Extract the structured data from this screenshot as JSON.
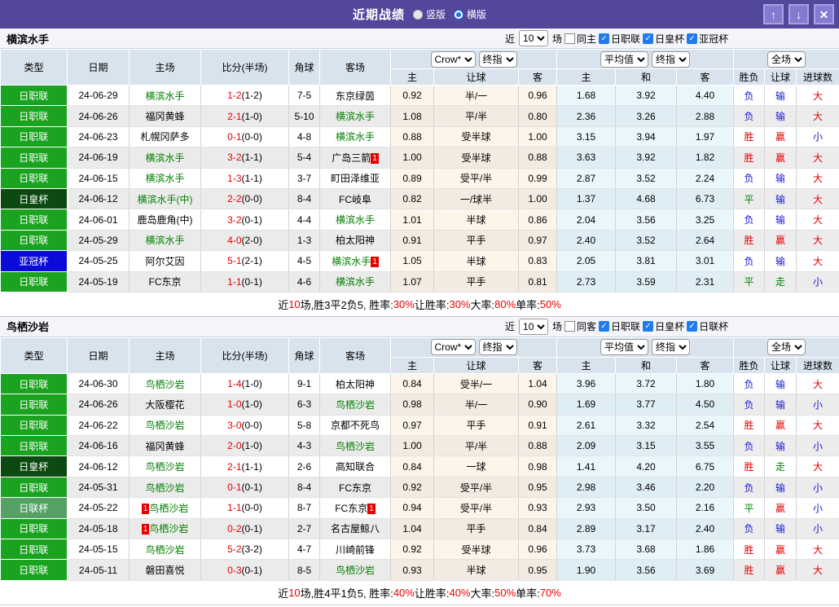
{
  "titlebar": {
    "title": "近期战绩",
    "layout_vertical": "竖版",
    "layout_horizontal": "横版",
    "selected_layout": "横版",
    "buttons": {
      "up": "↑",
      "down": "↓",
      "close": "✕"
    }
  },
  "filter_labels": {
    "near": "近",
    "games_unit": "场"
  },
  "table_header": {
    "main": [
      "类型",
      "日期",
      "主场",
      "比分(半场)",
      "角球",
      "客场"
    ],
    "sub": [
      "主",
      "让球",
      "客",
      "主",
      "和",
      "客",
      "胜负",
      "让球",
      "进球数"
    ],
    "odds_selects": {
      "bookmaker": "Crow*",
      "bookmaker_stage": "终指",
      "average": "平均值",
      "average_stage": "终指",
      "scope": "全场"
    }
  },
  "colors": {
    "titlebar_bg": "#53479c",
    "button_bg": "#837bd0",
    "header_bg": "#d9e3ee",
    "checkbox_blue": "#1f7bf0",
    "score_red": "#e60000",
    "focus_team": "#008000",
    "types": {
      "日职联": "#1aa31e",
      "日皇杯": "#0d4a12",
      "亚冠杯": "#0a0ad9",
      "日联杯": "#55a065"
    },
    "verdict": {
      "r": "#e60000",
      "b": "#1616d1",
      "g": "#008a00"
    }
  },
  "sections": [
    {
      "team": "横滨水手",
      "filter": {
        "games": "10",
        "same_label": "同主",
        "same_checked": false,
        "leagues": [
          {
            "label": "日职联",
            "checked": true
          },
          {
            "label": "日皇杯",
            "checked": true
          },
          {
            "label": "亚冠杯",
            "checked": true
          }
        ]
      },
      "rows": [
        {
          "type": "日职联",
          "date": "24-06-29",
          "home": {
            "name": "横滨水手",
            "focus": true
          },
          "score": "1-2",
          "half": "(1-2)",
          "corner": "7-5",
          "away": {
            "name": "东京绿茵"
          },
          "crow": [
            "0.92",
            "半/一",
            "0.96"
          ],
          "avg": [
            "1.68",
            "3.92",
            "4.40"
          ],
          "verdicts": [
            [
              "负",
              "b"
            ],
            [
              "输",
              "b"
            ],
            [
              "大",
              "r"
            ]
          ]
        },
        {
          "type": "日职联",
          "date": "24-06-26",
          "home": {
            "name": "福冈黄蜂"
          },
          "score": "2-1",
          "half": "(1-0)",
          "corner": "5-10",
          "away": {
            "name": "横滨水手",
            "focus": true
          },
          "crow": [
            "1.08",
            "平/半",
            "0.80"
          ],
          "avg": [
            "2.36",
            "3.26",
            "2.88"
          ],
          "verdicts": [
            [
              "负",
              "b"
            ],
            [
              "输",
              "b"
            ],
            [
              "大",
              "r"
            ]
          ]
        },
        {
          "type": "日职联",
          "date": "24-06-23",
          "home": {
            "name": "札幌冈萨多"
          },
          "score": "0-1",
          "half": "(0-0)",
          "corner": "4-8",
          "away": {
            "name": "横滨水手",
            "focus": true
          },
          "crow": [
            "0.88",
            "受半球",
            "1.00"
          ],
          "avg": [
            "3.15",
            "3.94",
            "1.97"
          ],
          "verdicts": [
            [
              "胜",
              "r"
            ],
            [
              "赢",
              "r"
            ],
            [
              "小",
              "b"
            ]
          ]
        },
        {
          "type": "日职联",
          "date": "24-06-19",
          "home": {
            "name": "横滨水手",
            "focus": true
          },
          "score": "3-2",
          "half": "(1-1)",
          "corner": "5-4",
          "away": {
            "name": "广岛三箭",
            "badge": "1"
          },
          "crow": [
            "1.00",
            "受半球",
            "0.88"
          ],
          "avg": [
            "3.63",
            "3.92",
            "1.82"
          ],
          "verdicts": [
            [
              "胜",
              "r"
            ],
            [
              "赢",
              "r"
            ],
            [
              "大",
              "r"
            ]
          ]
        },
        {
          "type": "日职联",
          "date": "24-06-15",
          "home": {
            "name": "横滨水手",
            "focus": true
          },
          "score": "1-3",
          "half": "(1-1)",
          "corner": "3-7",
          "away": {
            "name": "町田泽维亚"
          },
          "crow": [
            "0.89",
            "受平/半",
            "0.99"
          ],
          "avg": [
            "2.87",
            "3.52",
            "2.24"
          ],
          "verdicts": [
            [
              "负",
              "b"
            ],
            [
              "输",
              "b"
            ],
            [
              "大",
              "r"
            ]
          ]
        },
        {
          "type": "日皇杯",
          "date": "24-06-12",
          "home": {
            "name": "横滨水手(中)",
            "focus": true
          },
          "score": "2-2",
          "half": "(0-0)",
          "corner": "8-4",
          "away": {
            "name": "FC岐阜"
          },
          "crow": [
            "0.82",
            "一/球半",
            "1.00"
          ],
          "avg": [
            "1.37",
            "4.68",
            "6.73"
          ],
          "verdicts": [
            [
              "平",
              "g"
            ],
            [
              "输",
              "b"
            ],
            [
              "大",
              "r"
            ]
          ]
        },
        {
          "type": "日职联",
          "date": "24-06-01",
          "home": {
            "name": "鹿岛鹿角(中)"
          },
          "score": "3-2",
          "half": "(0-1)",
          "corner": "4-4",
          "away": {
            "name": "横滨水手",
            "focus": true
          },
          "crow": [
            "1.01",
            "半球",
            "0.86"
          ],
          "avg": [
            "2.04",
            "3.56",
            "3.25"
          ],
          "verdicts": [
            [
              "负",
              "b"
            ],
            [
              "输",
              "b"
            ],
            [
              "大",
              "r"
            ]
          ]
        },
        {
          "type": "日职联",
          "date": "24-05-29",
          "home": {
            "name": "横滨水手",
            "focus": true
          },
          "score": "4-0",
          "half": "(2-0)",
          "corner": "1-3",
          "away": {
            "name": "柏太阳神"
          },
          "crow": [
            "0.91",
            "平手",
            "0.97"
          ],
          "avg": [
            "2.40",
            "3.52",
            "2.64"
          ],
          "verdicts": [
            [
              "胜",
              "r"
            ],
            [
              "赢",
              "r"
            ],
            [
              "大",
              "r"
            ]
          ]
        },
        {
          "type": "亚冠杯",
          "date": "24-05-25",
          "home": {
            "name": "阿尔艾因"
          },
          "score": "5-1",
          "half": "(2-1)",
          "corner": "4-5",
          "away": {
            "name": "横滨水手",
            "focus": true,
            "badge": "1"
          },
          "crow": [
            "1.05",
            "半球",
            "0.83"
          ],
          "avg": [
            "2.05",
            "3.81",
            "3.01"
          ],
          "verdicts": [
            [
              "负",
              "b"
            ],
            [
              "输",
              "b"
            ],
            [
              "大",
              "r"
            ]
          ]
        },
        {
          "type": "日职联",
          "date": "24-05-19",
          "home": {
            "name": "FC东京"
          },
          "score": "1-1",
          "half": "(0-1)",
          "corner": "4-6",
          "away": {
            "name": "横滨水手",
            "focus": true
          },
          "crow": [
            "1.07",
            "平手",
            "0.81"
          ],
          "avg": [
            "2.73",
            "3.59",
            "2.31"
          ],
          "verdicts": [
            [
              "平",
              "g"
            ],
            [
              "走",
              "g"
            ],
            [
              "小",
              "b"
            ]
          ]
        }
      ],
      "summary": [
        {
          "t": "近"
        },
        {
          "t": "10",
          "red": true
        },
        {
          "t": "场,胜3平2负5, 胜率:"
        },
        {
          "t": "30%",
          "red": true
        },
        {
          "t": " 让胜率:"
        },
        {
          "t": "30%",
          "red": true
        },
        {
          "t": " 大率:"
        },
        {
          "t": "80%",
          "red": true
        },
        {
          "t": " 单率:"
        },
        {
          "t": "50%",
          "red": true
        }
      ]
    },
    {
      "team": "鸟栖沙岩",
      "filter": {
        "games": "10",
        "same_label": "同客",
        "same_checked": false,
        "leagues": [
          {
            "label": "日职联",
            "checked": true
          },
          {
            "label": "日皇杯",
            "checked": true
          },
          {
            "label": "日联杯",
            "checked": true
          }
        ]
      },
      "rows": [
        {
          "type": "日职联",
          "date": "24-06-30",
          "home": {
            "name": "鸟栖沙岩",
            "focus": true
          },
          "score": "1-4",
          "half": "(1-0)",
          "corner": "9-1",
          "away": {
            "name": "柏太阳神"
          },
          "crow": [
            "0.84",
            "受半/一",
            "1.04"
          ],
          "avg": [
            "3.96",
            "3.72",
            "1.80"
          ],
          "verdicts": [
            [
              "负",
              "b"
            ],
            [
              "输",
              "b"
            ],
            [
              "大",
              "r"
            ]
          ]
        },
        {
          "type": "日职联",
          "date": "24-06-26",
          "home": {
            "name": "大阪樱花"
          },
          "score": "1-0",
          "half": "(1-0)",
          "corner": "6-3",
          "away": {
            "name": "鸟栖沙岩",
            "focus": true
          },
          "crow": [
            "0.98",
            "半/一",
            "0.90"
          ],
          "avg": [
            "1.69",
            "3.77",
            "4.50"
          ],
          "verdicts": [
            [
              "负",
              "b"
            ],
            [
              "输",
              "b"
            ],
            [
              "小",
              "b"
            ]
          ]
        },
        {
          "type": "日职联",
          "date": "24-06-22",
          "home": {
            "name": "鸟栖沙岩",
            "focus": true
          },
          "score": "3-0",
          "half": "(0-0)",
          "corner": "5-8",
          "away": {
            "name": "京都不死鸟"
          },
          "crow": [
            "0.97",
            "平手",
            "0.91"
          ],
          "avg": [
            "2.61",
            "3.32",
            "2.54"
          ],
          "verdicts": [
            [
              "胜",
              "r"
            ],
            [
              "赢",
              "r"
            ],
            [
              "大",
              "r"
            ]
          ]
        },
        {
          "type": "日职联",
          "date": "24-06-16",
          "home": {
            "name": "福冈黄蜂"
          },
          "score": "2-0",
          "half": "(1-0)",
          "corner": "4-3",
          "away": {
            "name": "鸟栖沙岩",
            "focus": true
          },
          "crow": [
            "1.00",
            "平/半",
            "0.88"
          ],
          "avg": [
            "2.09",
            "3.15",
            "3.55"
          ],
          "verdicts": [
            [
              "负",
              "b"
            ],
            [
              "输",
              "b"
            ],
            [
              "小",
              "b"
            ]
          ]
        },
        {
          "type": "日皇杯",
          "date": "24-06-12",
          "home": {
            "name": "鸟栖沙岩",
            "focus": true
          },
          "score": "2-1",
          "half": "(1-1)",
          "corner": "2-6",
          "away": {
            "name": "高知联合"
          },
          "crow": [
            "0.84",
            "一球",
            "0.98"
          ],
          "avg": [
            "1.41",
            "4.20",
            "6.75"
          ],
          "verdicts": [
            [
              "胜",
              "r"
            ],
            [
              "走",
              "g"
            ],
            [
              "大",
              "r"
            ]
          ]
        },
        {
          "type": "日职联",
          "date": "24-05-31",
          "home": {
            "name": "鸟栖沙岩",
            "focus": true
          },
          "score": "0-1",
          "half": "(0-1)",
          "corner": "8-4",
          "away": {
            "name": "FC东京"
          },
          "crow": [
            "0.92",
            "受平/半",
            "0.95"
          ],
          "avg": [
            "2.98",
            "3.46",
            "2.20"
          ],
          "verdicts": [
            [
              "负",
              "b"
            ],
            [
              "输",
              "b"
            ],
            [
              "小",
              "b"
            ]
          ]
        },
        {
          "type": "日联杯",
          "date": "24-05-22",
          "home": {
            "name": "鸟栖沙岩",
            "focus": true,
            "badge": "1"
          },
          "score": "1-1",
          "half": "(0-0)",
          "corner": "8-7",
          "away": {
            "name": "FC东京",
            "badge": "1"
          },
          "crow": [
            "0.94",
            "受平/半",
            "0.93"
          ],
          "avg": [
            "2.93",
            "3.50",
            "2.16"
          ],
          "verdicts": [
            [
              "平",
              "g"
            ],
            [
              "赢",
              "r"
            ],
            [
              "小",
              "b"
            ]
          ]
        },
        {
          "type": "日职联",
          "date": "24-05-18",
          "home": {
            "name": "鸟栖沙岩",
            "focus": true,
            "badge": "1"
          },
          "score": "0-2",
          "half": "(0-1)",
          "corner": "2-7",
          "away": {
            "name": "名古屋鲸八"
          },
          "crow": [
            "1.04",
            "平手",
            "0.84"
          ],
          "avg": [
            "2.89",
            "3.17",
            "2.40"
          ],
          "verdicts": [
            [
              "负",
              "b"
            ],
            [
              "输",
              "b"
            ],
            [
              "小",
              "b"
            ]
          ]
        },
        {
          "type": "日职联",
          "date": "24-05-15",
          "home": {
            "name": "鸟栖沙岩",
            "focus": true
          },
          "score": "5-2",
          "half": "(3-2)",
          "corner": "4-7",
          "away": {
            "name": "川崎前锋"
          },
          "crow": [
            "0.92",
            "受半球",
            "0.96"
          ],
          "avg": [
            "3.73",
            "3.68",
            "1.86"
          ],
          "verdicts": [
            [
              "胜",
              "r"
            ],
            [
              "赢",
              "r"
            ],
            [
              "大",
              "r"
            ]
          ]
        },
        {
          "type": "日职联",
          "date": "24-05-11",
          "home": {
            "name": "磐田喜悦"
          },
          "score": "0-3",
          "half": "(0-1)",
          "corner": "8-5",
          "away": {
            "name": "鸟栖沙岩",
            "focus": true
          },
          "crow": [
            "0.93",
            "半球",
            "0.95"
          ],
          "avg": [
            "1.90",
            "3.56",
            "3.69"
          ],
          "verdicts": [
            [
              "胜",
              "r"
            ],
            [
              "赢",
              "r"
            ],
            [
              "大",
              "r"
            ]
          ]
        }
      ],
      "summary": [
        {
          "t": "近"
        },
        {
          "t": "10",
          "red": true
        },
        {
          "t": "场,胜4平1负5, 胜率:"
        },
        {
          "t": "40%",
          "red": true
        },
        {
          "t": " 让胜率:"
        },
        {
          "t": "40%",
          "red": true
        },
        {
          "t": " 大率:"
        },
        {
          "t": "50%",
          "red": true
        },
        {
          "t": " 单率:"
        },
        {
          "t": "70%",
          "red": true
        }
      ]
    }
  ]
}
